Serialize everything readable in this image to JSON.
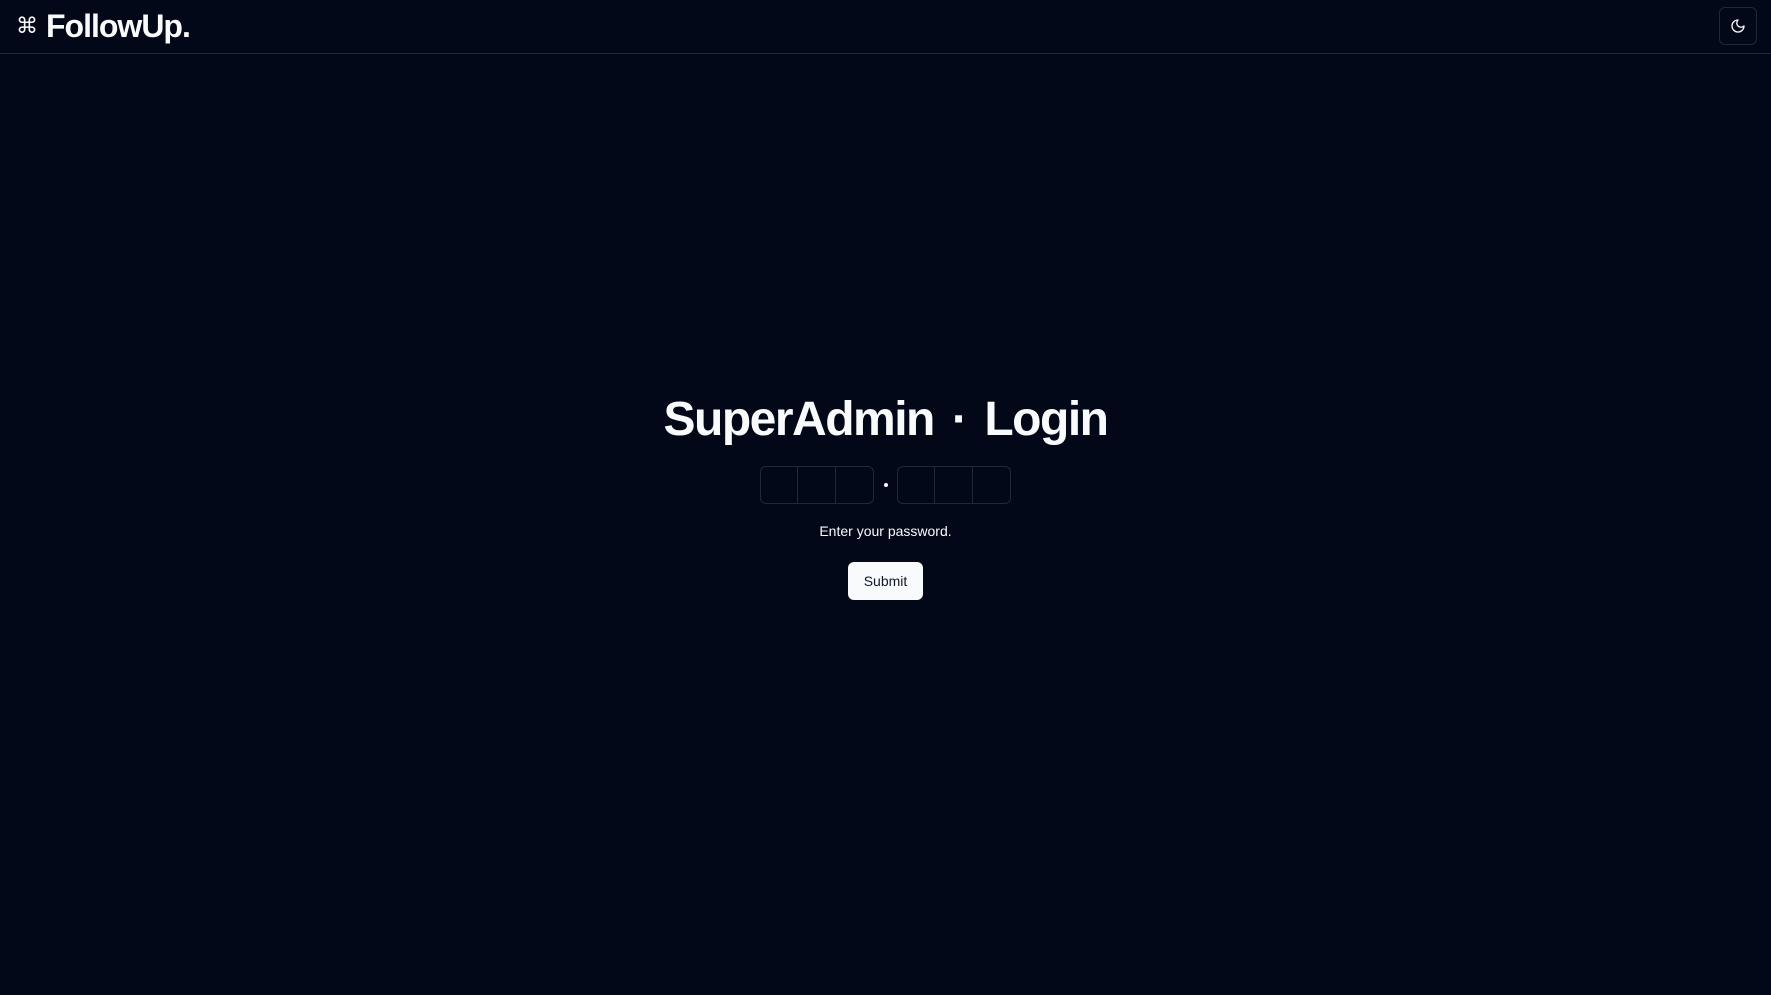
{
  "header": {
    "brand_icon": "command-icon",
    "brand_name": "FollowUp.",
    "theme_toggle_icon": "moon-icon"
  },
  "main": {
    "title_left": "SuperAdmin",
    "title_separator": "·",
    "title_right": "Login",
    "otp": {
      "group_1_slots": [
        "",
        "",
        ""
      ],
      "group_2_slots": [
        "",
        "",
        ""
      ]
    },
    "hint": "Enter your password.",
    "submit_label": "Submit"
  },
  "colors": {
    "background": "#020817",
    "foreground": "#f8fafc",
    "border": "#1e293b",
    "button_bg": "#f8fafc",
    "button_text": "#0f172a"
  }
}
